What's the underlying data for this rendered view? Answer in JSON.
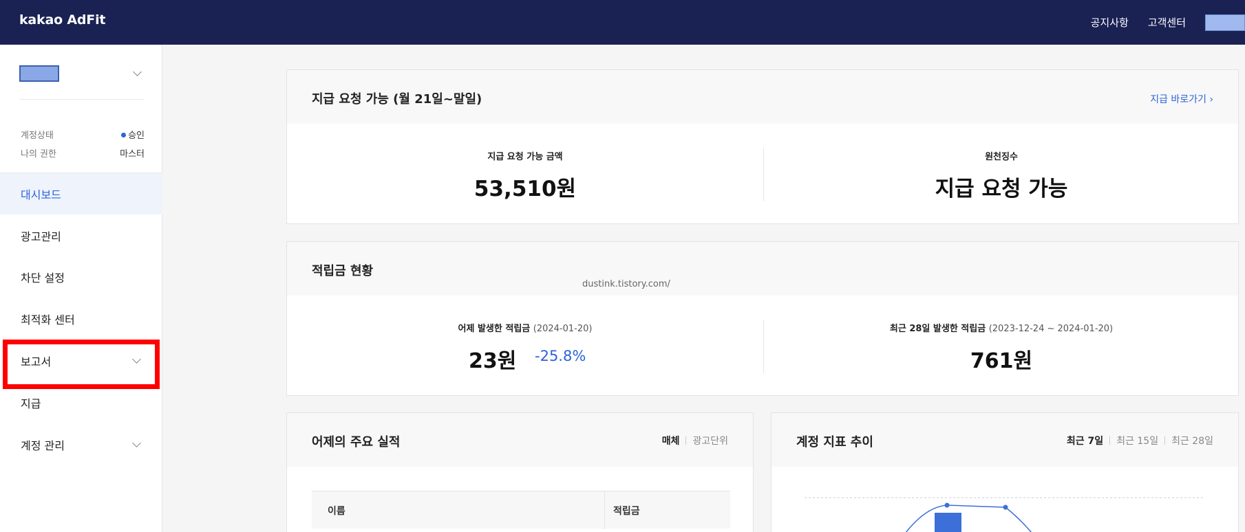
{
  "header": {
    "brand": "kakao AdFit",
    "nav": [
      "공지사항",
      "고객센터"
    ]
  },
  "sidebar": {
    "account_status_label": "계정상태",
    "account_status_value": "승인",
    "role_label": "나의 권한",
    "role_value": "마스터",
    "items": [
      {
        "label": "대시보드"
      },
      {
        "label": "광고관리"
      },
      {
        "label": "차단 설정"
      },
      {
        "label": "최적화 센터"
      },
      {
        "label": "보고서"
      },
      {
        "label": "지급"
      },
      {
        "label": "계정 관리"
      }
    ]
  },
  "payout_card": {
    "title": "지급 요청 가능 (월 21일~말일)",
    "link": "지급 바로가기 ›",
    "amount_label": "지급 요청 가능 금액",
    "amount_value": "53,510원",
    "tax_label": "원천징수",
    "tax_value": "지급 요청 가능"
  },
  "watermark": "dustink.tistory.com/",
  "earnings_card": {
    "title": "적립금 현황",
    "yesterday_label": "어제 발생한 적립금",
    "yesterday_date": "(2024-01-20)",
    "yesterday_value": "23원",
    "yesterday_delta": "-25.8%",
    "recent_label": "최근 28일 발생한 적립금",
    "recent_range": "(2023-12-24 ~ 2024-01-20)",
    "recent_value": "761원"
  },
  "performance_card": {
    "title": "어제의 주요 실적",
    "tabs": [
      "매체",
      "광고단위"
    ],
    "columns": [
      "이름",
      "적립금"
    ]
  },
  "trend_card": {
    "title": "계정 지표 추이",
    "tabs": [
      "최근 7일",
      "최근 15일",
      "최근 28일"
    ]
  },
  "colors": {
    "topbar": "#1a2254",
    "accent": "#2c63d8",
    "highlight": "#ff0000"
  }
}
